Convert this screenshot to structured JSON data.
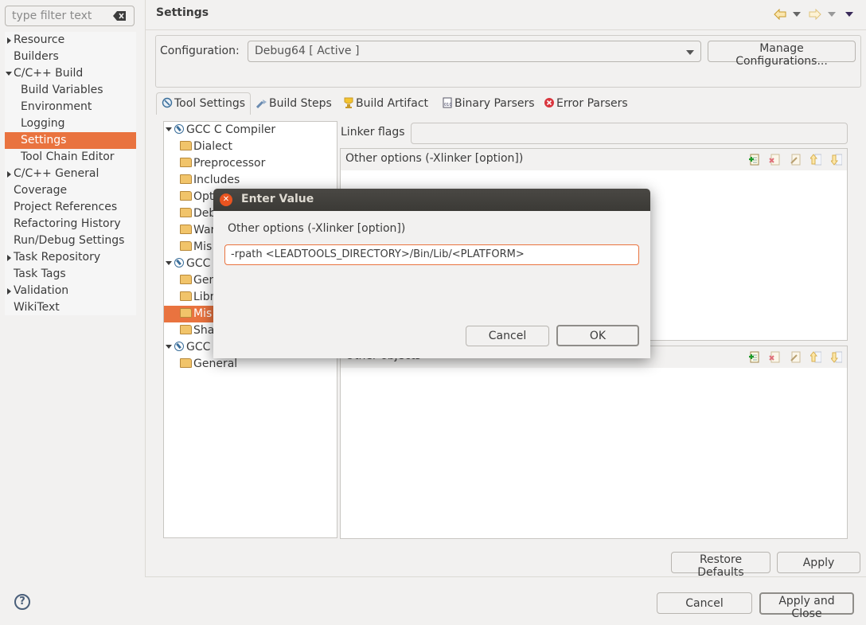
{
  "left_pane": {
    "filter": {
      "placeholder": "type filter text",
      "value": ""
    },
    "nav_items": [
      {
        "label": "Resource",
        "expander": "collapsed",
        "indent": 0
      },
      {
        "label": "Builders",
        "expander": "none",
        "indent": 0
      },
      {
        "label": "C/C++ Build",
        "expander": "expanded",
        "indent": 0
      },
      {
        "label": "Build Variables",
        "expander": "none",
        "indent": 1
      },
      {
        "label": "Environment",
        "expander": "none",
        "indent": 1
      },
      {
        "label": "Logging",
        "expander": "none",
        "indent": 1
      },
      {
        "label": "Settings",
        "expander": "none",
        "indent": 1,
        "selected": true
      },
      {
        "label": "Tool Chain Editor",
        "expander": "none",
        "indent": 1
      },
      {
        "label": "C/C++ General",
        "expander": "collapsed",
        "indent": 0
      },
      {
        "label": "Coverage",
        "expander": "none",
        "indent": 0
      },
      {
        "label": "Project References",
        "expander": "none",
        "indent": 0
      },
      {
        "label": "Refactoring History",
        "expander": "none",
        "indent": 0
      },
      {
        "label": "Run/Debug Settings",
        "expander": "none",
        "indent": 0
      },
      {
        "label": "Task Repository",
        "expander": "collapsed",
        "indent": 0
      },
      {
        "label": "Task Tags",
        "expander": "none",
        "indent": 0
      },
      {
        "label": "Validation",
        "expander": "collapsed",
        "indent": 0
      },
      {
        "label": "WikiText",
        "expander": "none",
        "indent": 0
      }
    ]
  },
  "header": {
    "title": "Settings",
    "nav_icons": [
      "back-arrow-icon",
      "back-menu-icon",
      "forward-arrow-icon",
      "forward-menu-icon",
      "view-menu-icon"
    ]
  },
  "configuration": {
    "label": "Configuration:",
    "selected": "Debug64  [ Active ]",
    "manage_button": "Manage Configurations..."
  },
  "tabs": [
    {
      "label": "Tool Settings",
      "icon": "tool-settings-icon",
      "active": true
    },
    {
      "label": "Build Steps",
      "icon": "build-steps-icon"
    },
    {
      "label": "Build Artifact",
      "icon": "build-artifact-icon"
    },
    {
      "label": "Binary Parsers",
      "icon": "binary-parsers-icon"
    },
    {
      "label": "Error Parsers",
      "icon": "error-parsers-icon"
    }
  ],
  "tool_tree": [
    {
      "label": "GCC C Compiler",
      "type": "tool"
    },
    {
      "label": "Dialect",
      "type": "category"
    },
    {
      "label": "Preprocessor",
      "type": "category"
    },
    {
      "label": "Includes",
      "type": "category"
    },
    {
      "label": "Opt",
      "type": "category"
    },
    {
      "label": "Deb",
      "type": "category"
    },
    {
      "label": "War",
      "type": "category"
    },
    {
      "label": "Mis",
      "type": "category"
    },
    {
      "label": "GCC C",
      "type": "tool"
    },
    {
      "label": "Gen",
      "type": "category"
    },
    {
      "label": "Libr",
      "type": "category"
    },
    {
      "label": "Mis",
      "type": "category",
      "selected": true
    },
    {
      "label": "Sha",
      "type": "category"
    },
    {
      "label": "GCC A",
      "type": "tool"
    },
    {
      "label": "General",
      "type": "category"
    }
  ],
  "linker": {
    "flags_label": "Linker flags",
    "flags_value": "",
    "other_options_title": "Other options (-Xlinker [option])",
    "other_objects_title": "Other objects",
    "toolbar": [
      "add-icon",
      "delete-icon",
      "edit-icon",
      "move-up-icon",
      "move-down-icon"
    ]
  },
  "buttons": {
    "restore_defaults": "Restore Defaults",
    "apply": "Apply",
    "cancel": "Cancel",
    "apply_and_close": "Apply and Close"
  },
  "dialog": {
    "title": "Enter Value",
    "label": "Other options (-Xlinker [option])",
    "value": "-rpath <LEADTOOLS_DIRECTORY>/Bin/Lib/<PLATFORM>",
    "cancel": "Cancel",
    "ok": "OK"
  },
  "colors": {
    "selection": "#e9733f",
    "dialog_titlebar": "#3f3e3a",
    "close_button": "#e95420"
  }
}
